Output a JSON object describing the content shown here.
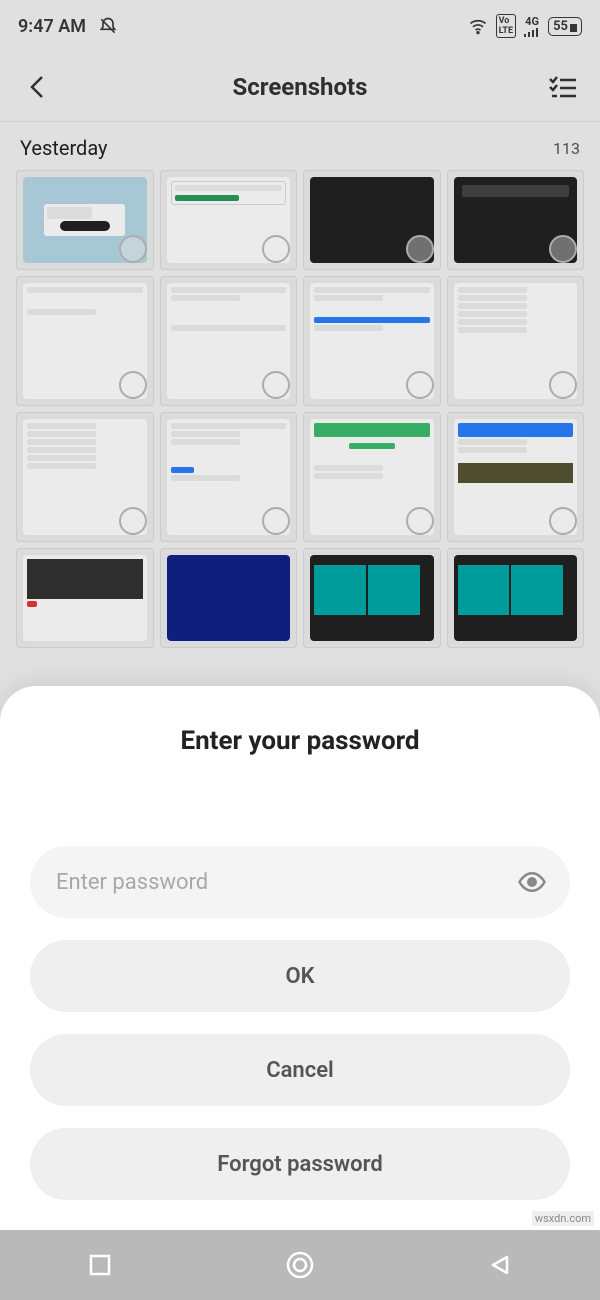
{
  "status": {
    "time": "9:47 AM",
    "battery": "55"
  },
  "header": {
    "title": "Screenshots"
  },
  "section": {
    "title": "Yesterday",
    "count": "113"
  },
  "modal": {
    "title": "Enter your password",
    "placeholder": "Enter password",
    "ok": "OK",
    "cancel": "Cancel",
    "forgot": "Forgot password"
  },
  "watermark": "wsxdn.com"
}
